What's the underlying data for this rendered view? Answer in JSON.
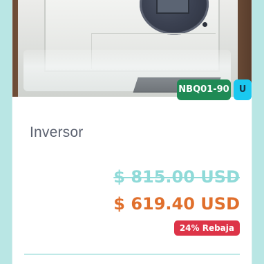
{
  "product": {
    "title": "Inversor",
    "sku": "NBQ01-90",
    "unit_badge": "U",
    "old_price": "$ 815.00 USD",
    "new_price": "$ 619.40 USD",
    "discount": "24% Rebaja"
  },
  "colors": {
    "sku_badge": "#1f8a55",
    "unit_badge": "#1ac8f0",
    "old_price": "#8fdad8",
    "new_price": "#e06f2c",
    "discount_badge": "#dd3448",
    "background": "#b9e6e4"
  }
}
